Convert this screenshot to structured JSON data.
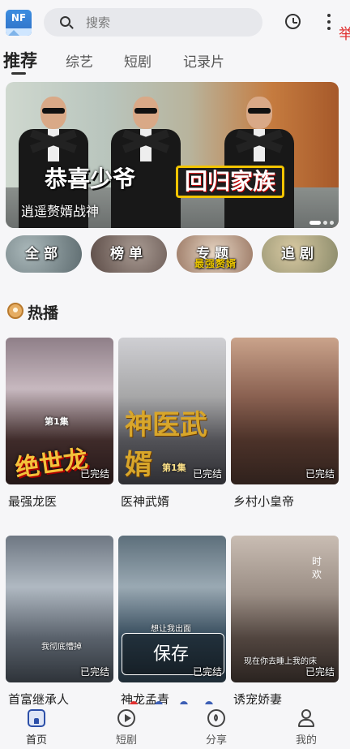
{
  "app": {
    "logo_text": "NF",
    "edge_char": "举"
  },
  "search": {
    "placeholder": "搜索",
    "value": ""
  },
  "tabs": [
    {
      "label": "推荐",
      "active": true
    },
    {
      "label": "综艺",
      "active": false
    },
    {
      "label": "短剧",
      "active": false
    },
    {
      "label": "记录片",
      "active": false
    }
  ],
  "banner": {
    "title_left": "恭喜少爷",
    "title_right": "回归家族",
    "caption": "逍遥赘婿战神"
  },
  "categories": [
    {
      "label": "全部"
    },
    {
      "label": "榜单"
    },
    {
      "label": "专题",
      "sub": "最强赘婿"
    },
    {
      "label": "追剧"
    }
  ],
  "hot": {
    "title": "热播"
  },
  "cards": [
    {
      "name": "最强龙医",
      "status": "已完结",
      "poster_ep": "第1集",
      "poster_text": "绝世龙医"
    },
    {
      "name": "医神武婿",
      "status": "已完结",
      "poster_ep": "第1集",
      "poster_text": "神医武婿"
    },
    {
      "name": "乡村小皇帝",
      "status": "已完结"
    },
    {
      "name": "首富继承人",
      "status": "已完结",
      "poster_hint": "我彻底懵掉"
    },
    {
      "name": "神龙孟青",
      "status": "已完结",
      "save_label": "保存",
      "poster_hint": "想让我出面"
    },
    {
      "name": "诱宠娇妻",
      "status": "已完结",
      "poster_hint": "现在你去睡上我的床",
      "poster_vertical": "时欢"
    }
  ],
  "bottom_nav": [
    {
      "label": "首页",
      "icon": "home-icon",
      "active": true
    },
    {
      "label": "短剧",
      "icon": "play-icon",
      "active": false
    },
    {
      "label": "分享",
      "icon": "compass-icon",
      "active": false
    },
    {
      "label": "我的",
      "icon": "user-icon",
      "active": false
    }
  ],
  "colors": {
    "accent": "#2c4fa8",
    "background": "#f6f6f8",
    "pager_dot": "#3d5fb5",
    "pager_dot_active": "#e03030"
  }
}
